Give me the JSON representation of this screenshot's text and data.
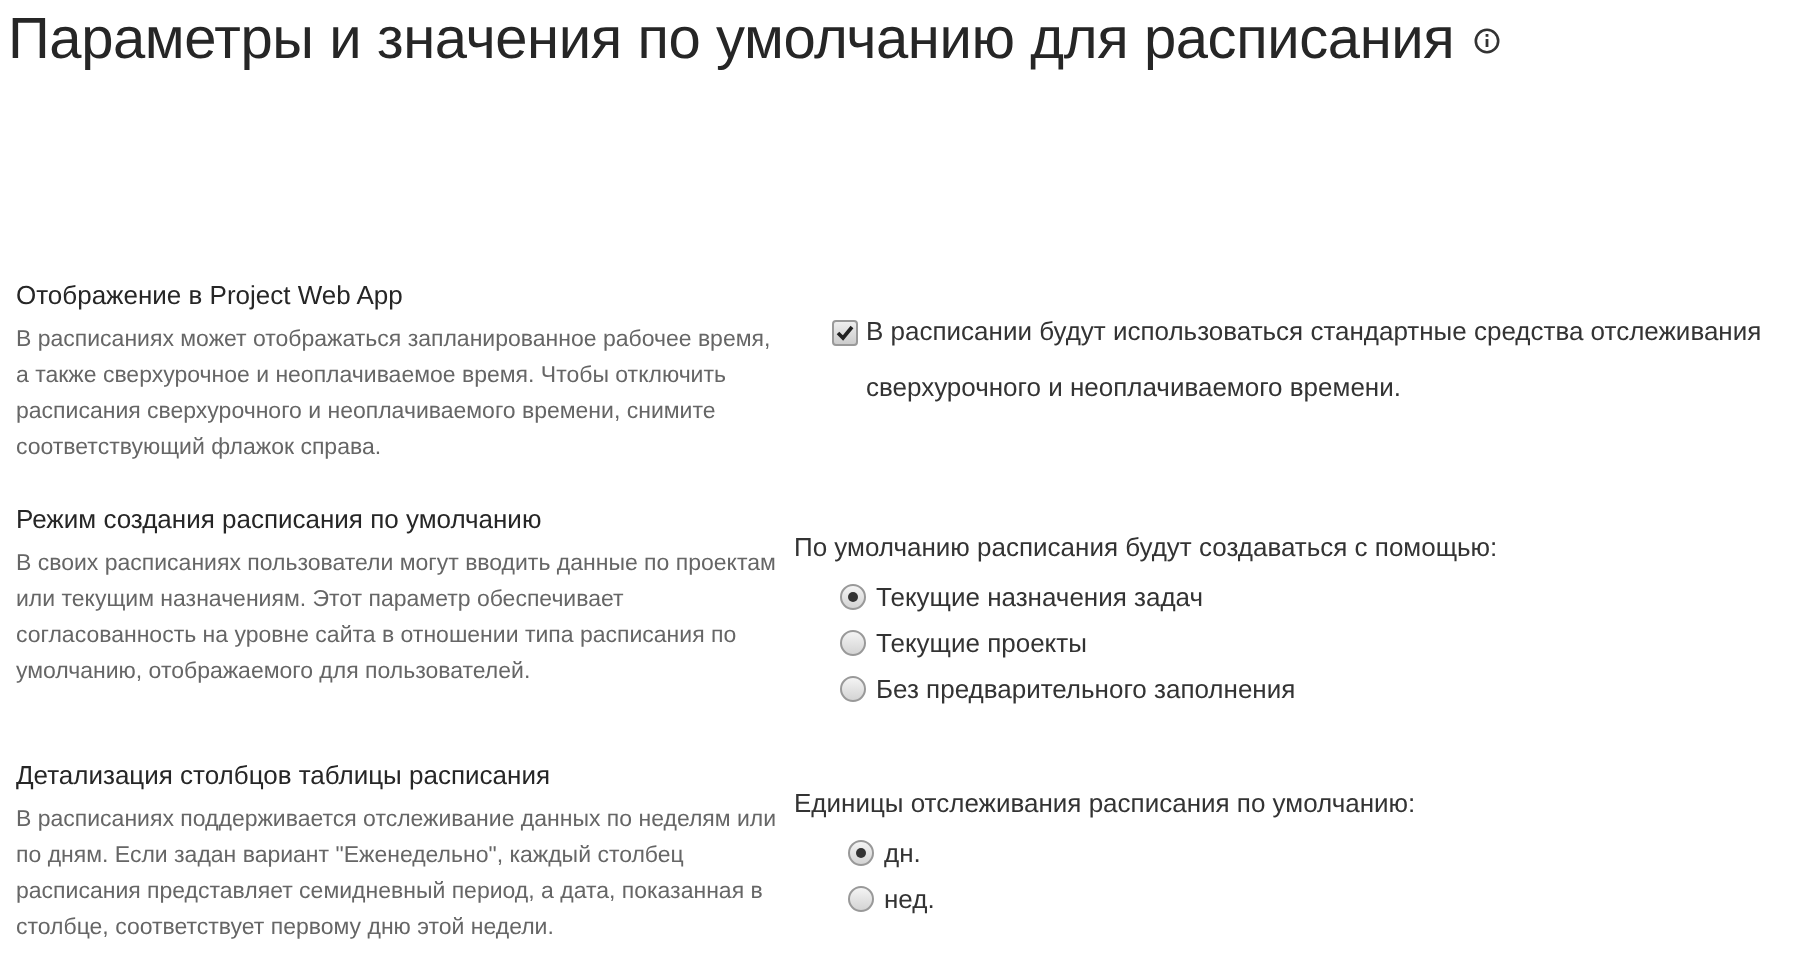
{
  "page_title": "Параметры и значения по умолчанию для расписания",
  "sections": [
    {
      "kind": "checkbox",
      "heading": "Отображение в Project Web App",
      "description": "В расписаниях может отображаться запланированное рабочее время, а также сверхурочное и неоплачиваемое время. Чтобы отключить расписания сверхурочного и неоплачиваемого времени, снимите соответствующий флажок справа.",
      "checked": true,
      "label_lines": [
        "В расписании будут использоваться стандартные средства отслеживания",
        "сверхурочного  и неоплачиваемого времени."
      ]
    },
    {
      "kind": "radio",
      "heading": "Режим создания расписания по умолчанию",
      "description": "В своих расписаниях пользователи могут вводить данные по проектам или текущим назначениям. Этот параметр обеспечивает согласованность на уровне сайта в отношении типа расписания по умолчанию, отображаемого для пользователей.",
      "prompt": "По умолчанию расписания будут создаваться с помощью:",
      "options": [
        {
          "label": "Текущие назначения задач",
          "selected": true
        },
        {
          "label": "Текущие проекты",
          "selected": false
        },
        {
          "label": "Без предварительного заполнения",
          "selected": false
        }
      ]
    },
    {
      "kind": "radio",
      "heading": "Детализация столбцов таблицы расписания",
      "description": "В расписаниях поддерживается отслеживание данных по неделям или по дням. Если задан вариант \"Еженедельно\", каждый столбец расписания представляет семидневный период, а дата, показанная в столбце, соответствует первому дню этой недели.",
      "prompt": "Единицы отслеживания расписания по умолчанию:",
      "options": [
        {
          "label": "дн.",
          "selected": true
        },
        {
          "label": "нед.",
          "selected": false
        }
      ]
    }
  ]
}
